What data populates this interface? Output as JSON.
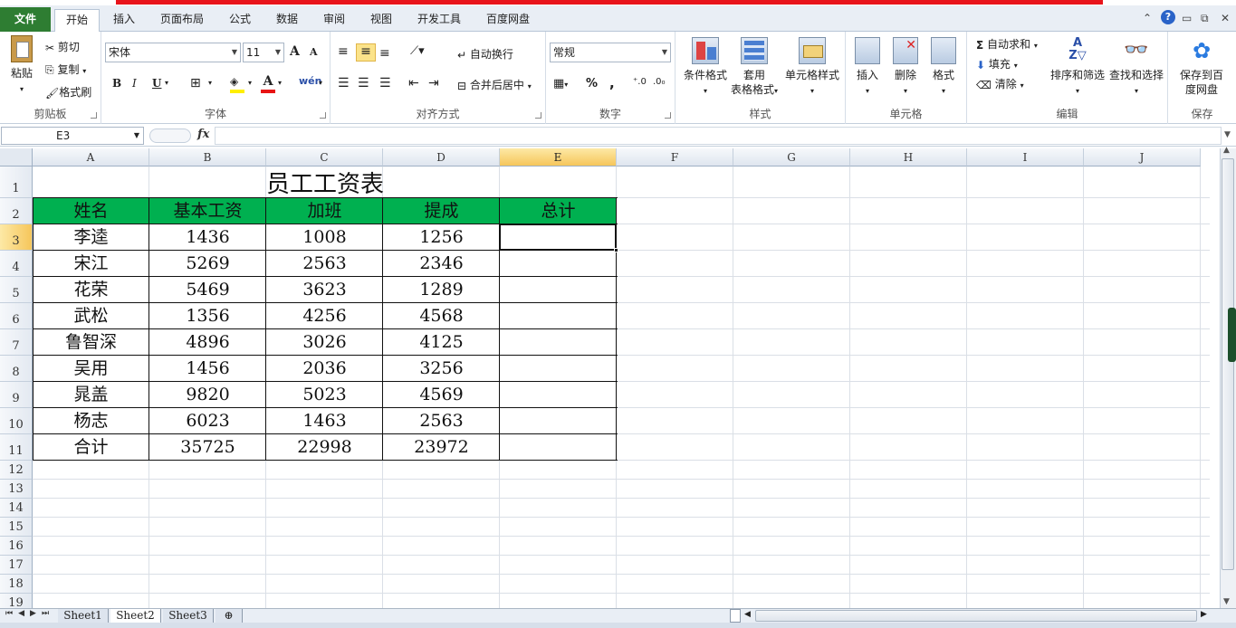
{
  "ribbon_tabs": [
    "文件",
    "开始",
    "插入",
    "页面布局",
    "公式",
    "数据",
    "审阅",
    "视图",
    "开发工具",
    "百度网盘"
  ],
  "active_tab": "开始",
  "clipboard": {
    "paste": "粘贴",
    "cut": "剪切",
    "copy": "复制",
    "format_painter": "格式刷",
    "label": "剪贴板"
  },
  "font": {
    "name": "宋体",
    "size": "11",
    "bold": "B",
    "italic": "I",
    "underline": "U",
    "label": "字体",
    "grow": "A",
    "shrink": "A"
  },
  "alignment": {
    "wrap": "自动换行",
    "merge": "合并后居中",
    "label": "对齐方式"
  },
  "number": {
    "format": "常规",
    "percent": "%",
    "comma": ",",
    "label": "数字"
  },
  "styles": {
    "conditional": "条件格式",
    "table_format_1": "套用",
    "table_format_2": "表格格式",
    "cell_styles": "单元格样式",
    "label": "样式"
  },
  "cells": {
    "insert": "插入",
    "delete": "删除",
    "format": "格式",
    "label": "单元格"
  },
  "editing": {
    "autosum": "自动求和",
    "fill": "填充",
    "clear": "清除",
    "sort_filter": "排序和筛选",
    "find_select": "查找和选择",
    "label": "编辑"
  },
  "save": {
    "save_1": "保存到百",
    "save_2": "度网盘",
    "label": "保存"
  },
  "formula_bar": {
    "name_box": "E3",
    "fx": "fx",
    "content": ""
  },
  "columns": [
    "A",
    "B",
    "C",
    "D",
    "E",
    "F",
    "G",
    "H",
    "I",
    "J"
  ],
  "rows": [
    "1",
    "2",
    "3",
    "4",
    "5",
    "6",
    "7",
    "8",
    "9",
    "10",
    "11",
    "12",
    "13",
    "14",
    "15",
    "16",
    "17",
    "18",
    "19"
  ],
  "active_cell": {
    "column": "E",
    "row": "3"
  },
  "sheet": {
    "title": "员工工资表",
    "headers": [
      "姓名",
      "基本工资",
      "加班",
      "提成",
      "总计"
    ],
    "data": [
      [
        "李逵",
        "1436",
        "1008",
        "1256",
        ""
      ],
      [
        "宋江",
        "5269",
        "2563",
        "2346",
        ""
      ],
      [
        "花荣",
        "5469",
        "3623",
        "1289",
        ""
      ],
      [
        "武松",
        "1356",
        "4256",
        "4568",
        ""
      ],
      [
        "鲁智深",
        "4896",
        "3026",
        "4125",
        ""
      ],
      [
        "吴用",
        "1456",
        "2036",
        "3256",
        ""
      ],
      [
        "晁盖",
        "9820",
        "5023",
        "4569",
        ""
      ],
      [
        "杨志",
        "6023",
        "1463",
        "2563",
        ""
      ],
      [
        "合计",
        "35725",
        "22998",
        "23972",
        ""
      ]
    ]
  },
  "sheet_tabs": [
    "Sheet1",
    "Sheet2",
    "Sheet3"
  ],
  "active_sheet": "Sheet2",
  "colors": {
    "header_fill": "#00b050",
    "file_tab": "#2e7d32",
    "accent_red": "#e8141b"
  }
}
